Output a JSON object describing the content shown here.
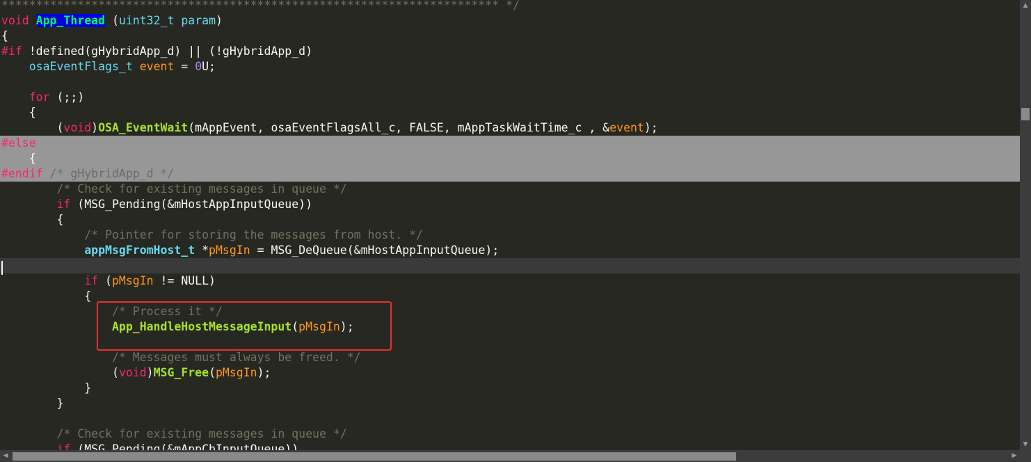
{
  "editor": {
    "theme": {
      "background": "#272822",
      "keyword": "#f92672",
      "type": "#66d9ef",
      "function": "#a6e22e",
      "parameter": "#fd971f",
      "number": "#ae81ff",
      "comment": "#75715e",
      "text": "#f8f8f2",
      "inactive_region": "#979797",
      "current_line": "#3a3a3a",
      "annotation_box": "#e8302a"
    },
    "current_line_index": 17,
    "annotated_lines": [
      20,
      21
    ],
    "lines": [
      {
        "state": "normal",
        "tokens": [
          {
            "t": "cm",
            "v": "************************************************************************ */"
          }
        ]
      },
      {
        "state": "normal",
        "tokens": [
          {
            "t": "kw",
            "v": "void"
          },
          {
            "t": "tx",
            "v": " "
          },
          {
            "t": "hl",
            "v": "App_Thread"
          },
          {
            "t": "tx",
            "v": " ("
          },
          {
            "t": "ty",
            "v": "uint32_t"
          },
          {
            "t": "tx",
            "v": " "
          },
          {
            "t": "ty",
            "v": "param"
          },
          {
            "t": "tx",
            "v": ")"
          }
        ]
      },
      {
        "state": "normal",
        "tokens": [
          {
            "t": "tx",
            "v": "{"
          }
        ]
      },
      {
        "state": "normal",
        "tokens": [
          {
            "t": "kw",
            "v": "#if"
          },
          {
            "t": "tx",
            "v": " !defined(gHybridApp_d) || (!gHybridApp_d)"
          }
        ]
      },
      {
        "state": "normal",
        "tokens": [
          {
            "t": "tx",
            "v": "    "
          },
          {
            "t": "ty",
            "v": "osaEventFlags_t"
          },
          {
            "t": "tx",
            "v": " "
          },
          {
            "t": "pr",
            "v": "event"
          },
          {
            "t": "tx",
            "v": " = "
          },
          {
            "t": "nu",
            "v": "0"
          },
          {
            "t": "tx",
            "v": "U;"
          }
        ]
      },
      {
        "state": "normal",
        "tokens": []
      },
      {
        "state": "normal",
        "tokens": [
          {
            "t": "tx",
            "v": "    "
          },
          {
            "t": "kw",
            "v": "for"
          },
          {
            "t": "tx",
            "v": " (;;)"
          }
        ]
      },
      {
        "state": "normal",
        "tokens": [
          {
            "t": "tx",
            "v": "    {"
          }
        ]
      },
      {
        "state": "normal",
        "tokens": [
          {
            "t": "tx",
            "v": "        ("
          },
          {
            "t": "kw",
            "v": "void"
          },
          {
            "t": "tx",
            "v": ")"
          },
          {
            "t": "fnb",
            "v": "OSA_EventWait"
          },
          {
            "t": "tx",
            "v": "(mAppEvent, osaEventFlagsAll_c, FALSE, mAppTaskWaitTime_c , &"
          },
          {
            "t": "pr",
            "v": "event"
          },
          {
            "t": "tx",
            "v": ");"
          }
        ]
      },
      {
        "state": "inactive",
        "tokens": [
          {
            "t": "kw",
            "v": "#else"
          }
        ]
      },
      {
        "state": "inactive",
        "tokens": [
          {
            "t": "tx",
            "v": "    {"
          }
        ]
      },
      {
        "state": "inactive",
        "tokens": [
          {
            "t": "kw",
            "v": "#endif"
          },
          {
            "t": "tx",
            "v": " "
          },
          {
            "t": "cm",
            "v": "/* gHybridApp_d */"
          }
        ]
      },
      {
        "state": "normal",
        "tokens": [
          {
            "t": "tx",
            "v": "        "
          },
          {
            "t": "cm",
            "v": "/* Check for existing messages in queue */"
          }
        ]
      },
      {
        "state": "normal",
        "tokens": [
          {
            "t": "tx",
            "v": "        "
          },
          {
            "t": "kw",
            "v": "if"
          },
          {
            "t": "tx",
            "v": " (MSG_Pending(&mHostAppInputQueue))"
          }
        ]
      },
      {
        "state": "normal",
        "tokens": [
          {
            "t": "tx",
            "v": "        {"
          }
        ]
      },
      {
        "state": "normal",
        "tokens": [
          {
            "t": "tx",
            "v": "            "
          },
          {
            "t": "cm",
            "v": "/* Pointer for storing the messages from host. */"
          }
        ]
      },
      {
        "state": "normal",
        "tokens": [
          {
            "t": "tx",
            "v": "            "
          },
          {
            "t": "tyb",
            "v": "appMsgFromHost_t"
          },
          {
            "t": "tx",
            "v": " *"
          },
          {
            "t": "pr",
            "v": "pMsgIn"
          },
          {
            "t": "tx",
            "v": " = MSG_DeQueue(&mHostAppInputQueue);"
          }
        ]
      },
      {
        "state": "current",
        "tokens": []
      },
      {
        "state": "normal",
        "tokens": [
          {
            "t": "tx",
            "v": "            "
          },
          {
            "t": "kw",
            "v": "if"
          },
          {
            "t": "tx",
            "v": " ("
          },
          {
            "t": "pr",
            "v": "pMsgIn"
          },
          {
            "t": "tx",
            "v": " != NULL)"
          }
        ]
      },
      {
        "state": "normal",
        "tokens": [
          {
            "t": "tx",
            "v": "            {"
          }
        ]
      },
      {
        "state": "normal",
        "tokens": [
          {
            "t": "tx",
            "v": "                "
          },
          {
            "t": "cm",
            "v": "/* Process it */"
          }
        ]
      },
      {
        "state": "normal",
        "tokens": [
          {
            "t": "tx",
            "v": "                "
          },
          {
            "t": "fnb",
            "v": "App_HandleHostMessageInput"
          },
          {
            "t": "tx",
            "v": "("
          },
          {
            "t": "pr",
            "v": "pMsgIn"
          },
          {
            "t": "tx",
            "v": ");"
          }
        ]
      },
      {
        "state": "normal",
        "tokens": []
      },
      {
        "state": "normal",
        "tokens": [
          {
            "t": "tx",
            "v": "                "
          },
          {
            "t": "cm",
            "v": "/* Messages must always be freed. */"
          }
        ]
      },
      {
        "state": "normal",
        "tokens": [
          {
            "t": "tx",
            "v": "                ("
          },
          {
            "t": "kw",
            "v": "void"
          },
          {
            "t": "tx",
            "v": ")"
          },
          {
            "t": "fnb",
            "v": "MSG_Free"
          },
          {
            "t": "tx",
            "v": "("
          },
          {
            "t": "pr",
            "v": "pMsgIn"
          },
          {
            "t": "tx",
            "v": ");"
          }
        ]
      },
      {
        "state": "normal",
        "tokens": [
          {
            "t": "tx",
            "v": "            }"
          }
        ]
      },
      {
        "state": "normal",
        "tokens": [
          {
            "t": "tx",
            "v": "        }"
          }
        ]
      },
      {
        "state": "normal",
        "tokens": []
      },
      {
        "state": "normal",
        "tokens": [
          {
            "t": "tx",
            "v": "        "
          },
          {
            "t": "cm",
            "v": "/* Check for existing messages in queue */"
          }
        ]
      },
      {
        "state": "normal",
        "tokens": [
          {
            "t": "tx",
            "v": "        "
          },
          {
            "t": "kw",
            "v": "if"
          },
          {
            "t": "tx",
            "v": " (MSG_Pending(&mAppCbInputQueue))"
          }
        ]
      }
    ]
  },
  "scrollbars": {
    "vertical_up_icon": "arrow-up-icon",
    "vertical_down_icon": "arrow-down-icon",
    "horizontal_left_icon": "arrow-left-icon",
    "horizontal_right_icon": "arrow-right-icon"
  }
}
